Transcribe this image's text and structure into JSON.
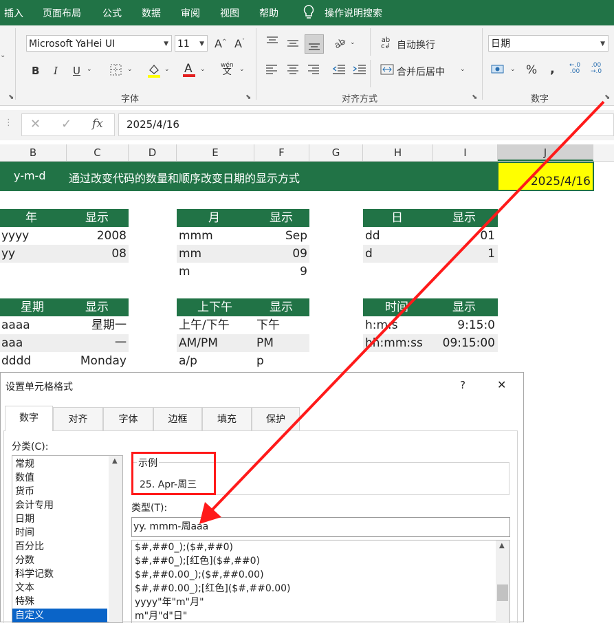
{
  "menu": {
    "insert": "插入",
    "page_layout": "页面布局",
    "formulas": "公式",
    "data": "数据",
    "review": "审阅",
    "view": "视图",
    "help": "帮助",
    "search": "操作说明搜索"
  },
  "ribbon": {
    "font_name": "Microsoft YaHei UI",
    "font_size": "11",
    "bold": "B",
    "italic": "I",
    "underline": "U",
    "font_group": "字体",
    "wrap_text": "自动换行",
    "merge_center": "合并后居中",
    "align_group": "对齐方式",
    "number_format": "日期",
    "percent": "%",
    "comma": ",",
    "number_group": "数字",
    "phonetic": "wén",
    "inc_decimal": ".00",
    "dec_decimal": ".0"
  },
  "formula_bar": {
    "fx": "fx",
    "value": "2025/4/16"
  },
  "columns": [
    "B",
    "C",
    "D",
    "E",
    "F",
    "G",
    "H",
    "I",
    "J"
  ],
  "sheet": {
    "banner_code": "y-m-d",
    "banner_text": "通过改变代码的数量和顺序改变日期的显示方式",
    "date_value": "2025/4/16",
    "year": {
      "h1": "年",
      "h2": "显示",
      "rows": [
        [
          "yyyy",
          "2008"
        ],
        [
          "yy",
          "08"
        ]
      ]
    },
    "month": {
      "h1": "月",
      "h2": "显示",
      "rows": [
        [
          "mmm",
          "Sep"
        ],
        [
          "mm",
          "09"
        ],
        [
          "m",
          "9"
        ]
      ]
    },
    "day": {
      "h1": "日",
      "h2": "显示",
      "rows": [
        [
          "dd",
          "01"
        ],
        [
          "d",
          "1"
        ]
      ]
    },
    "week": {
      "h1": "星期",
      "h2": "显示",
      "rows": [
        [
          "aaaa",
          "星期一"
        ],
        [
          "aaa",
          "一"
        ],
        [
          "dddd",
          "Monday"
        ]
      ]
    },
    "ampm": {
      "h1": "上下午",
      "h2": "显示",
      "rows": [
        [
          "上午/下午",
          "下午"
        ],
        [
          "AM/PM",
          "PM"
        ],
        [
          "a/p",
          "p"
        ]
      ]
    },
    "time": {
      "h1": "时间",
      "h2": "显示",
      "rows": [
        [
          "h:m:s",
          "9:15:0"
        ],
        [
          "hh:mm:ss",
          "09:15:00"
        ]
      ]
    }
  },
  "dialog": {
    "title": "设置单元格格式",
    "help": "?",
    "close": "✕",
    "tabs": [
      "数字",
      "对齐",
      "字体",
      "边框",
      "填充",
      "保护"
    ],
    "category_label": "分类(C):",
    "categories": [
      "常规",
      "数值",
      "货币",
      "会计专用",
      "日期",
      "时间",
      "百分比",
      "分数",
      "科学记数",
      "文本",
      "特殊",
      "自定义"
    ],
    "selected_category": "自定义",
    "sample_label": "示例",
    "sample_value": "25. Apr-周三",
    "type_label": "类型(T):",
    "type_value": "yy. mmm-周aaa",
    "formats": [
      "$#,##0_);($#,##0)",
      "$#,##0_);[红色]($#,##0)",
      "$#,##0.00_);($#,##0.00)",
      "$#,##0.00_);[红色]($#,##0.00)",
      "yyyy\"年\"m\"月\"",
      "m\"月\"d\"日\""
    ]
  },
  "colors": {
    "excel_green": "#217346",
    "highlight_yellow": "#ffff00",
    "annotation_red": "#ff1a1a",
    "selection_blue": "#0a64c8"
  }
}
